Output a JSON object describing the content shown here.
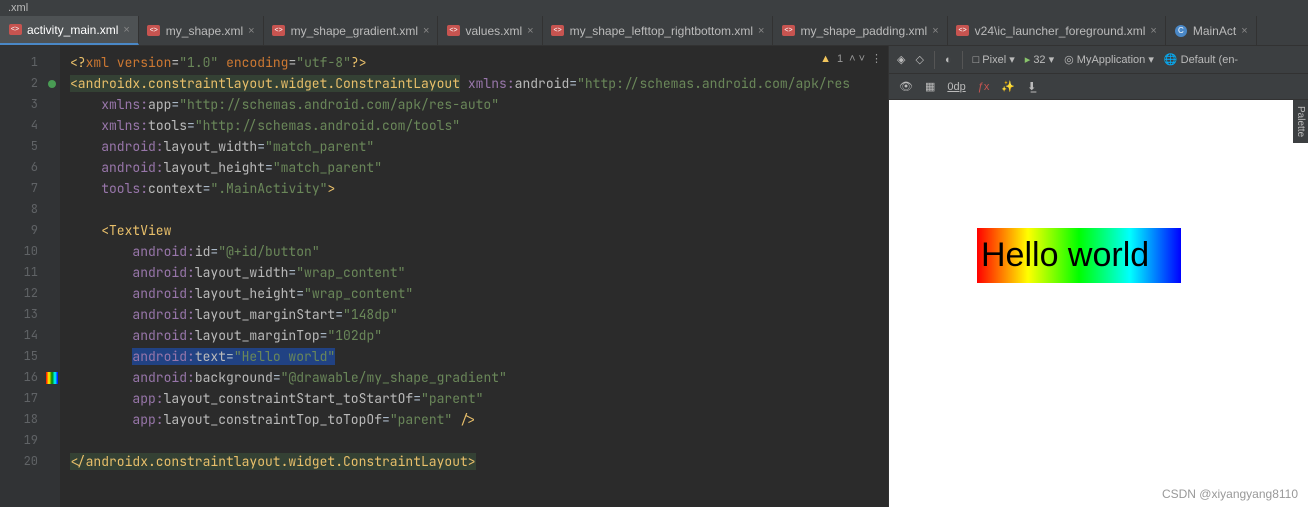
{
  "title_bar": ".xml",
  "tabs": [
    {
      "label": "activity_main.xml",
      "active": true,
      "icon": "xml"
    },
    {
      "label": "my_shape.xml",
      "active": false,
      "icon": "xml"
    },
    {
      "label": "my_shape_gradient.xml",
      "active": false,
      "icon": "xml"
    },
    {
      "label": "values.xml",
      "active": false,
      "icon": "xml"
    },
    {
      "label": "my_shape_lefttop_rightbottom.xml",
      "active": false,
      "icon": "xml"
    },
    {
      "label": "my_shape_padding.xml",
      "active": false,
      "icon": "xml"
    },
    {
      "label": "v24\\ic_launcher_foreground.xml",
      "active": false,
      "icon": "xml"
    },
    {
      "label": "MainAct",
      "active": false,
      "icon": "class"
    }
  ],
  "warn": {
    "count": "1",
    "arrow": "˄ ˅"
  },
  "code_lines": [
    {
      "n": 1,
      "html": "<span class='tagc'>&lt;?</span><span class='kw'>xml version</span><span class='attr'>=</span><span class='str'>\"1.0\"</span> <span class='kw'>encoding</span><span class='attr'>=</span><span class='str'>\"utf-8\"</span><span class='tagc'>?&gt;</span>"
    },
    {
      "n": 2,
      "marker": "circ",
      "html": "<span class='hl2'><span class='tagc'>&lt;androidx.constraintlayout.widget.ConstraintLayout</span></span> <span class='ns'>xmlns:</span><span class='attr'>android</span>=<span class='str'>\"http://schemas.android.com/apk/res</span>"
    },
    {
      "n": 3,
      "html": "    <span class='ns'>xmlns:</span><span class='attr'>app</span>=<span class='str'>\"http://schemas.android.com/apk/res-auto\"</span>"
    },
    {
      "n": 4,
      "html": "    <span class='ns'>xmlns:</span><span class='attr'>tools</span>=<span class='str'>\"http://schemas.android.com/tools\"</span>"
    },
    {
      "n": 5,
      "html": "    <span class='ns'>android:</span><span class='attr'>layout_width</span>=<span class='str'>\"match_parent\"</span>"
    },
    {
      "n": 6,
      "html": "    <span class='ns'>android:</span><span class='attr'>layout_height</span>=<span class='str'>\"match_parent\"</span>"
    },
    {
      "n": 7,
      "html": "    <span class='ns'>tools:</span><span class='attr'>context</span>=<span class='str'>\".MainActivity\"</span><span class='tagc'>&gt;</span>"
    },
    {
      "n": 8,
      "html": ""
    },
    {
      "n": 9,
      "html": "    <span class='tagc'>&lt;TextView</span>"
    },
    {
      "n": 10,
      "html": "        <span class='ns'>android:</span><span class='attr'>id</span>=<span class='str'>\"@+id/button\"</span>"
    },
    {
      "n": 11,
      "html": "        <span class='ns'>android:</span><span class='attr'>layout_width</span>=<span class='str'>\"wrap_content\"</span>"
    },
    {
      "n": 12,
      "html": "        <span class='ns'>android:</span><span class='attr'>layout_height</span>=<span class='str'>\"wrap_content\"</span>"
    },
    {
      "n": 13,
      "html": "        <span class='ns'>android:</span><span class='attr'>layout_marginStart</span>=<span class='str'>\"148dp\"</span>"
    },
    {
      "n": 14,
      "html": "        <span class='ns'>android:</span><span class='attr'>layout_marginTop</span>=<span class='str'>\"102dp\"</span>"
    },
    {
      "n": 15,
      "html": "        <span class='hl'><span class='ns'>android:</span><span class='attr'>text</span>=<span class='str'>\"Hello world\"</span></span>"
    },
    {
      "n": 16,
      "marker": "grad",
      "html": "        <span class='ns'>android:</span><span class='attr'>background</span>=<span class='str'>\"@drawable/my_shape_gradient\"</span>"
    },
    {
      "n": 17,
      "html": "        <span class='ns'>app:</span><span class='attr'>layout_constraintStart_toStartOf</span>=<span class='str'>\"parent\"</span>"
    },
    {
      "n": 18,
      "html": "        <span class='ns'>app:</span><span class='attr'>layout_constraintTop_toTopOf</span>=<span class='str'>\"parent\"</span> <span class='tagc'>/&gt;</span>"
    },
    {
      "n": 19,
      "html": ""
    },
    {
      "n": 20,
      "html": "<span class='hl2'><span class='tagc'>&lt;/androidx.constraintlayout.widget.ConstraintLayout&gt;</span></span>"
    }
  ],
  "preview": {
    "device": "Pixel",
    "api": "32",
    "app": "MyApplication",
    "locale": "Default (en-",
    "zoom": "0dp",
    "hello_text": "Hello world",
    "palette_label": "Palette"
  },
  "watermark": "CSDN @xiyangyang8110"
}
